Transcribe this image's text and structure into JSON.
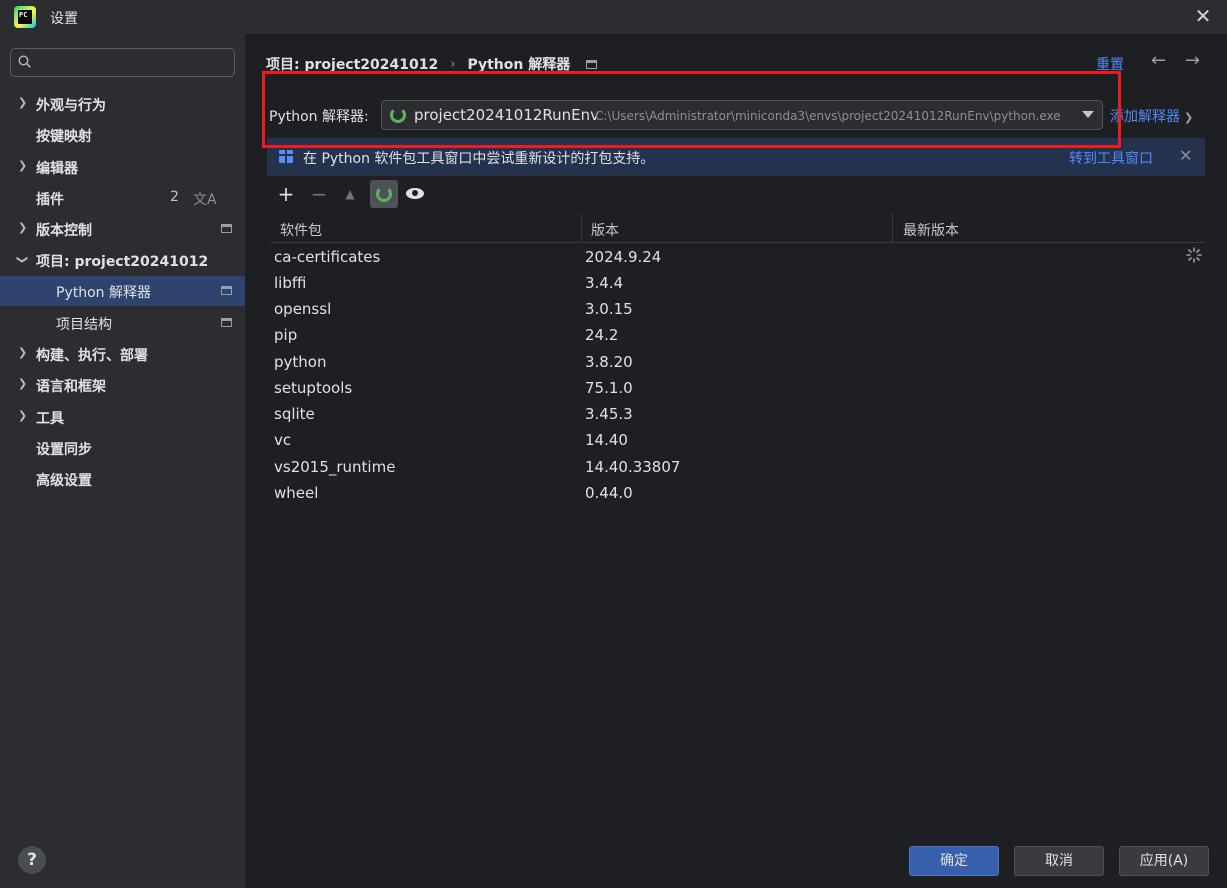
{
  "window": {
    "title": "设置",
    "logo_text": "PC"
  },
  "search": {
    "value": "",
    "placeholder": ""
  },
  "sidebar": {
    "items": [
      {
        "label": "外观与行为",
        "expandable": true
      },
      {
        "label": "按键映射",
        "expandable": false
      },
      {
        "label": "编辑器",
        "expandable": true
      },
      {
        "label": "插件",
        "expandable": false,
        "badge": "2"
      },
      {
        "label": "版本控制",
        "expandable": true
      },
      {
        "label": "项目: project20241012",
        "expandable": true,
        "expanded": true
      },
      {
        "label": "Python 解释器",
        "child": true,
        "selected": true
      },
      {
        "label": "项目结构",
        "child": true
      },
      {
        "label": "构建、执行、部署",
        "expandable": true
      },
      {
        "label": "语言和框架",
        "expandable": true
      },
      {
        "label": "工具",
        "expandable": true
      },
      {
        "label": "设置同步",
        "expandable": false
      },
      {
        "label": "高级设置",
        "expandable": false
      }
    ]
  },
  "breadcrumb": {
    "project": "项目: project20241012",
    "page": "Python 解释器"
  },
  "header": {
    "reset_label": "重置"
  },
  "interpreter": {
    "label": "Python 解释器:",
    "env_name": "project20241012RunEnv",
    "env_path": "C:\\Users\\Administrator\\miniconda3\\envs\\project20241012RunEnv\\python.exe",
    "add_label": "添加解释器"
  },
  "banner": {
    "message": "在 Python 软件包工具窗口中尝试重新设计的打包支持。",
    "link": "转到工具窗口"
  },
  "table": {
    "headers": [
      "软件包",
      "版本",
      "最新版本"
    ],
    "rows": [
      {
        "name": "ca-certificates",
        "version": "2024.9.24"
      },
      {
        "name": "libffi",
        "version": "3.4.4"
      },
      {
        "name": "openssl",
        "version": "3.0.15"
      },
      {
        "name": "pip",
        "version": "24.2"
      },
      {
        "name": "python",
        "version": "3.8.20"
      },
      {
        "name": "setuptools",
        "version": "75.1.0"
      },
      {
        "name": "sqlite",
        "version": "3.45.3"
      },
      {
        "name": "vc",
        "version": "14.40"
      },
      {
        "name": "vs2015_runtime",
        "version": "14.40.33807"
      },
      {
        "name": "wheel",
        "version": "0.44.0"
      }
    ]
  },
  "footer": {
    "ok": "确定",
    "cancel": "取消",
    "apply": "应用(A)"
  },
  "colors": {
    "accent": "#548af7",
    "selection": "#2e436e",
    "highlight": "#ee1c1c",
    "spinner": "#5fb25f"
  }
}
